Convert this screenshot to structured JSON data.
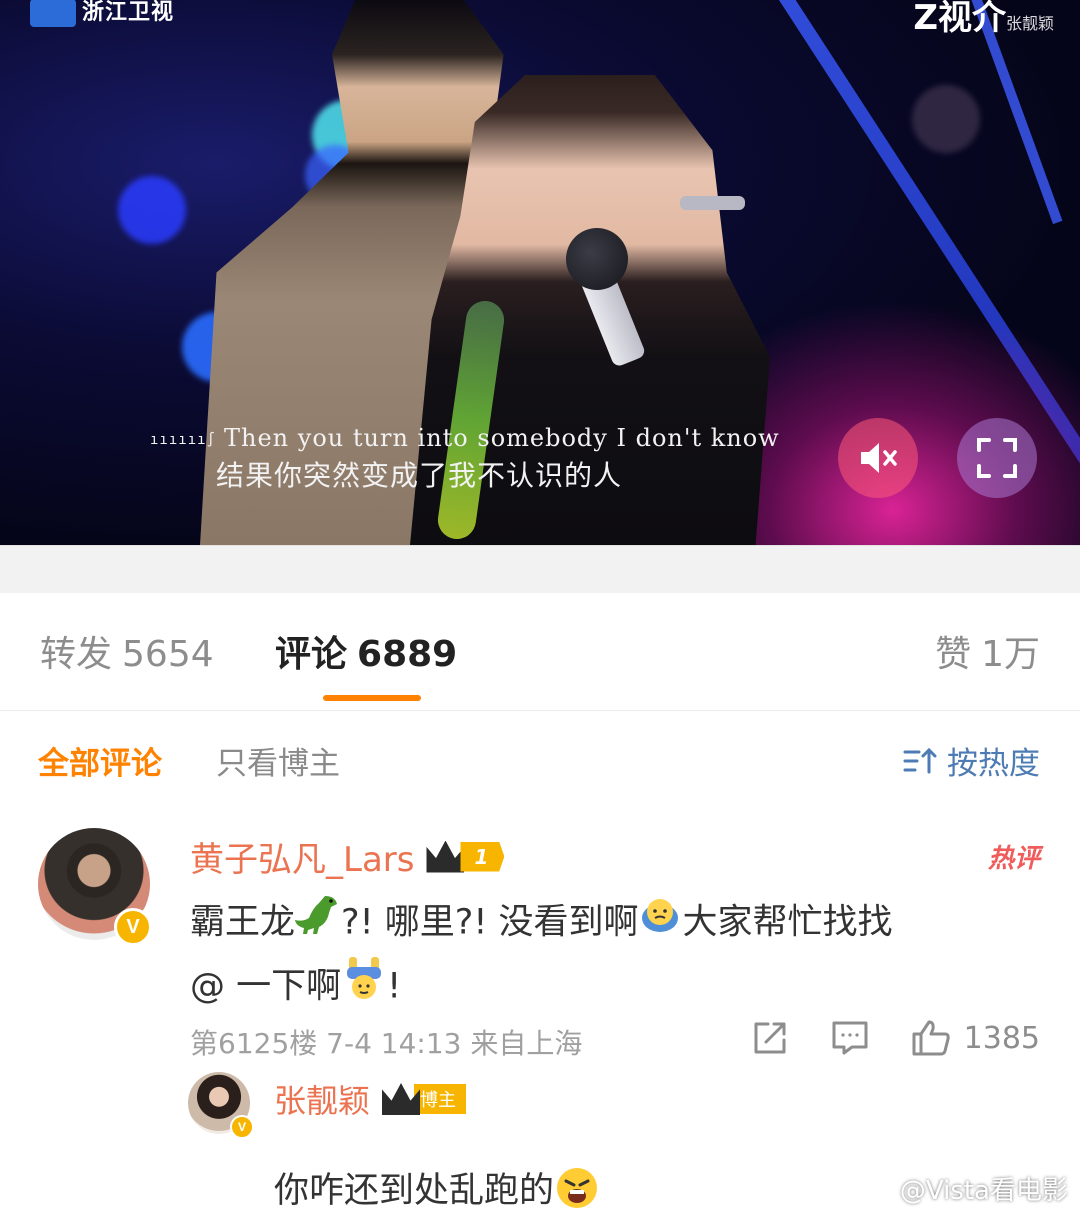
{
  "video": {
    "logo_left": "浙江卫视",
    "logo_right": "Z视介",
    "logo_right_sub": "张靓颖",
    "subtitle_en": "Then you turn into somebody I don't know",
    "subtitle_zh": "结果你突然变成了我不认识的人",
    "mute_icon": "speaker-muted-icon",
    "fullscreen_icon": "fullscreen-icon"
  },
  "stats": {
    "repost_label": "转发",
    "repost_count": "5654",
    "comments_label": "评论",
    "comments_count": "6889",
    "likes_label": "赞",
    "likes_count": "1万"
  },
  "filter": {
    "all_comments": "全部评论",
    "host_only": "只看博主",
    "sort_label": "按热度"
  },
  "comment": {
    "username": "黄子弘凡_Lars",
    "level": "1",
    "hot_tag": "热评",
    "text_part1": "霸王龙",
    "text_part2": "?! 哪里?! 没看到啊",
    "text_part3": "大家帮忙找找",
    "text_part4": "@ 一下啊",
    "text_part5": "!",
    "floor": "第6125楼",
    "time": "7-4 14:13",
    "location": "来自上海",
    "like_count": "1385",
    "reply": {
      "username": "张靓颖",
      "badge": "博主",
      "text": "你咋还到处乱跑的"
    }
  },
  "watermark": "@Vista看电影",
  "colors": {
    "accent": "#ff8200",
    "username": "#eb7350",
    "link_blue": "#4d7bb3",
    "hot_red": "#f05b5b",
    "vip_gold": "#f7b500"
  }
}
